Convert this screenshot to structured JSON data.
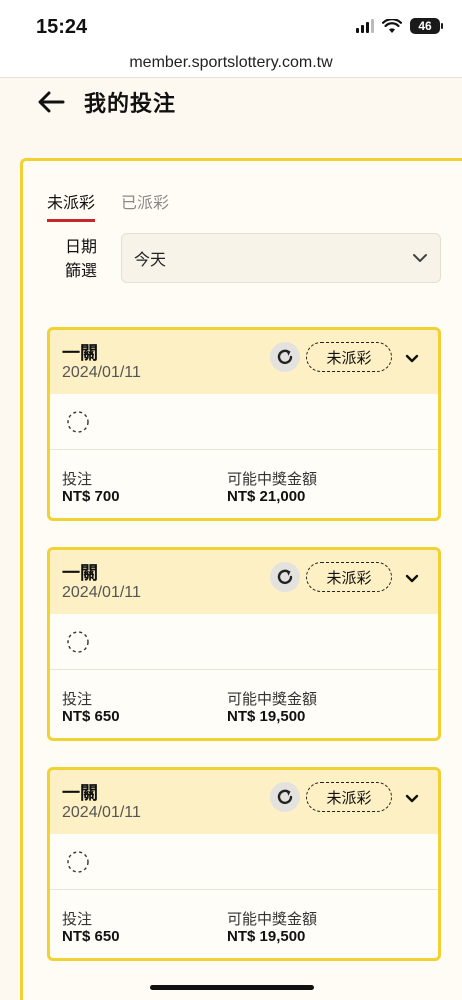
{
  "status_bar": {
    "time": "15:24",
    "battery": "46"
  },
  "url": "member.sportslottery.com.tw",
  "header": {
    "title": "我的投注"
  },
  "tabs": [
    {
      "label": "未派彩",
      "active": true
    },
    {
      "label": "已派彩",
      "active": false
    }
  ],
  "filter": {
    "label_line1": "日期",
    "label_line2": "篩選",
    "value": "今天"
  },
  "bets": [
    {
      "type": "一關",
      "date": "2024/01/11",
      "status": "未派彩",
      "stake_label": "投注",
      "stake": "NT$ 700",
      "payout_label": "可能中獎金額",
      "payout": "NT$ 21,000"
    },
    {
      "type": "一關",
      "date": "2024/01/11",
      "status": "未派彩",
      "stake_label": "投注",
      "stake": "NT$ 650",
      "payout_label": "可能中獎金額",
      "payout": "NT$ 19,500"
    },
    {
      "type": "一關",
      "date": "2024/01/11",
      "status": "未派彩",
      "stake_label": "投注",
      "stake": "NT$ 650",
      "payout_label": "可能中獎金額",
      "payout": "NT$ 19,500"
    }
  ],
  "colors": {
    "accent": "#f2d233",
    "tab_underline": "#c8262b",
    "card_header": "#fdf0c4"
  }
}
